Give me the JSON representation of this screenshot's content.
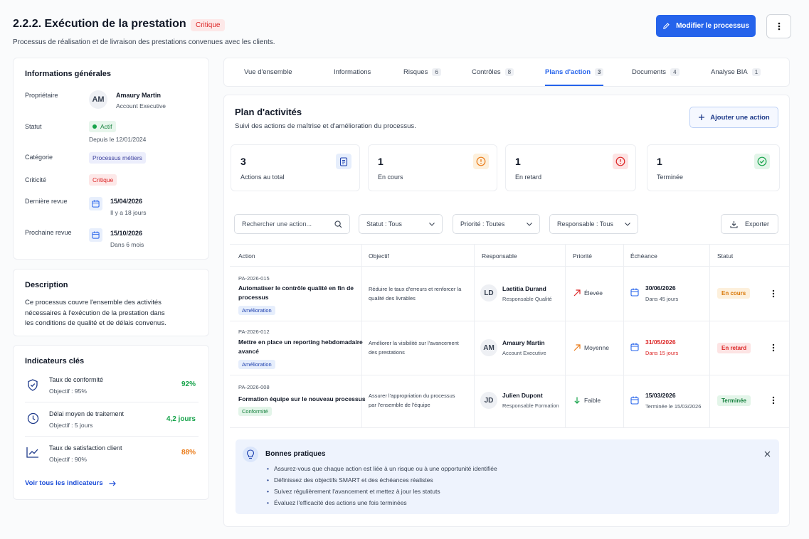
{
  "header": {
    "title": "2.2.2. Exécution de la prestation",
    "badge": "Critique",
    "subtitle": "Processus de réalisation et de livraison des prestations convenues avec les clients.",
    "primary_button": "Modifier le processus"
  },
  "general": {
    "title": "Informations générales",
    "owner_label": "Propriétaire",
    "owner_initials": "AM",
    "owner_name": "Amaury Martin",
    "owner_role": "Account Executive",
    "status_label": "Statut",
    "status_value": "Actif",
    "status_since": "Depuis le 12/01/2024",
    "category_label": "Catégorie",
    "category_value": "Processus métiers",
    "criticality_label": "Criticité",
    "criticality_value": "Critique",
    "last_review_label": "Dernière revue",
    "last_review_date": "15/04/2026",
    "last_review_ago": "Il y a 18 jours",
    "next_review_label": "Prochaine revue",
    "next_review_date": "15/10/2026",
    "next_review_in": "Dans 6 mois"
  },
  "description": {
    "title": "Description",
    "line1": "Ce processus couvre l'ensemble des activités",
    "line2": "nécessaires à l'exécution de la prestation dans",
    "line3": "les conditions de qualité et de délais convenus."
  },
  "indicators": {
    "title": "Indicateurs clés",
    "items": [
      {
        "label": "Taux de conformité",
        "target": "Objectif : 95%",
        "value": "92%",
        "color": "#16a34a",
        "icon": "shield-check-icon"
      },
      {
        "label": "Délai moyen de traitement",
        "target": "Objectif : 5 jours",
        "value": "4,2 jours",
        "color": "#16a34a",
        "icon": "clock-icon"
      },
      {
        "label": "Taux de satisfaction client",
        "target": "Objectif : 90%",
        "value": "88%",
        "color": "#ea7a17",
        "icon": "trend-chart-icon"
      }
    ],
    "link": "Voir tous les indicateurs"
  },
  "tabs": [
    {
      "label": "Vue d'ensemble",
      "count": ""
    },
    {
      "label": "Informations",
      "count": ""
    },
    {
      "label": "Risques",
      "count": "6"
    },
    {
      "label": "Contrôles",
      "count": "8"
    },
    {
      "label": "Plans d'action",
      "count": "3"
    },
    {
      "label": "Documents",
      "count": "4"
    },
    {
      "label": "Analyse BIA",
      "count": "1"
    }
  ],
  "plan": {
    "title": "Plan d'activités",
    "subtitle": "Suivi des actions de maîtrise et d'amélioration du processus.",
    "add_button": "Ajouter une action"
  },
  "stats": [
    {
      "value": "3",
      "label": "Actions au total"
    },
    {
      "value": "1",
      "label": "En cours"
    },
    {
      "value": "1",
      "label": "En retard"
    },
    {
      "value": "1",
      "label": "Terminée"
    }
  ],
  "filters": {
    "search_placeholder": "Rechercher une action...",
    "status": "Statut : Tous",
    "priority": "Priorité : Toutes",
    "owner": "Responsable : Tous",
    "export": "Exporter"
  },
  "table": {
    "headers": [
      "Action",
      "Objectif",
      "Responsable",
      "Priorité",
      "Échéance",
      "Statut"
    ],
    "rows": [
      {
        "code": "PA-2026-015",
        "title1": "Automatiser le contrôle qualité en fin de",
        "title2": "processus",
        "tag": "Amélioration",
        "obj1": "Réduire le taux d'erreurs et renforcer la",
        "obj2": "qualité des livrables",
        "initials": "LD",
        "name": "Laetitia Durand",
        "role": "Responsable Qualité",
        "priority": "Élevée",
        "date": "30/06/2026",
        "date_sub": "Dans 45 jours",
        "status": "En cours"
      },
      {
        "code": "PA-2026-012",
        "title1": "Mettre en place un reporting hebdomadaire",
        "title2": "avancé",
        "tag": "Amélioration",
        "obj1": "Améliorer la visibilité sur l'avancement",
        "obj2": "des prestations",
        "initials": "AM",
        "name": "Amaury Martin",
        "role": "Account Executive",
        "priority": "Moyenne",
        "date": "31/05/2026",
        "date_sub": "Dans 15 jours",
        "status": "En retard"
      },
      {
        "code": "PA-2026-008",
        "title1": "Formation équipe sur le nouveau processus",
        "title2": "",
        "tag": "Conformité",
        "obj1": "Assurer l'appropriation du processus",
        "obj2": "par l'ensemble de l'équipe",
        "initials": "JD",
        "name": "Julien Dupont",
        "role": "Responsable Formation",
        "priority": "Faible",
        "date": "15/03/2026",
        "date_sub": "Terminée le 15/03/2026",
        "status": "Terminée"
      }
    ]
  },
  "tips": {
    "title": "Bonnes pratiques",
    "items": [
      "Assurez-vous que chaque action est liée à un risque ou à une opportunité identifiée",
      "Définissez des objectifs SMART et des échéances réalistes",
      "Suivez régulièrement l'avancement et mettez à jour les statuts",
      "Évaluez l'efficacité des actions une fois terminées"
    ]
  }
}
